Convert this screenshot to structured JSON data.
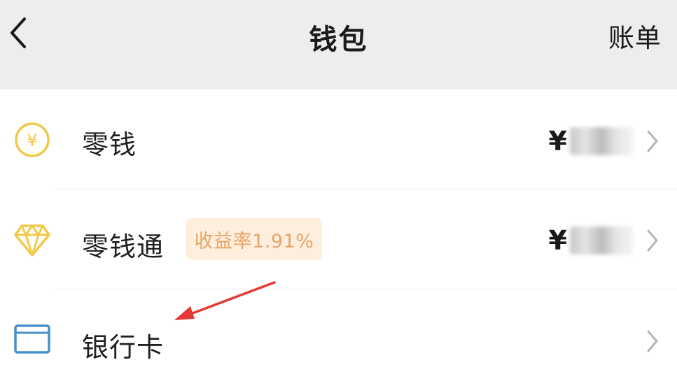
{
  "header": {
    "title": "钱包",
    "bill_label": "账单",
    "back_icon": "back-arrow-icon",
    "background": "#ededed"
  },
  "rows": [
    {
      "label": "零钱",
      "amount_prefix": "¥",
      "icon": "yuan-coin-icon",
      "icon_color": "#f2c94c"
    },
    {
      "label": "零钱通",
      "badge": "收益率1.91%",
      "amount_prefix": "¥",
      "icon": "diamond-icon",
      "icon_color": "#f2c94c",
      "badge_color": "#e8a465",
      "badge_bg": "#fdeede"
    },
    {
      "label": "银行卡",
      "icon": "bank-card-icon",
      "icon_color": "#4a90c8"
    }
  ],
  "annotation": {
    "arrow_color": "#e53935"
  }
}
